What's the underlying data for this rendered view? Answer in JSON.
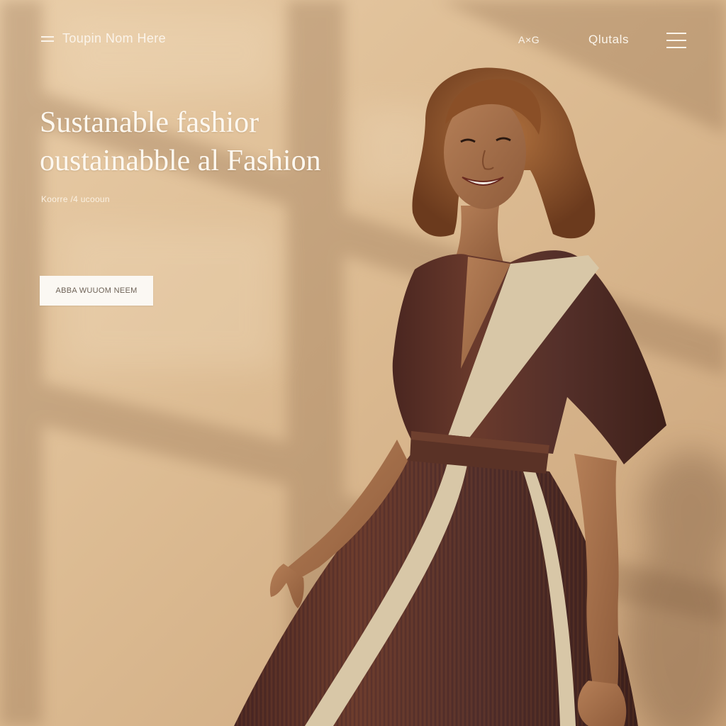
{
  "header": {
    "brand_name": "Toupin Nom Here",
    "nav_links": [
      "A×G",
      "Qlutals"
    ],
    "menu_icon": "hamburger-icon",
    "brand_menu_icon": "menu-icon"
  },
  "hero": {
    "title_line_1": "Sustanable fashior",
    "title_line_2": "oustainabble al Fashion",
    "subtitle": "Koorre /4 ucooun",
    "cta_label": "ABBA WUUOM NEEM"
  },
  "colors": {
    "background": "#dcbb92",
    "text_light": "#fbf4ea",
    "button_bg": "#fbf8f3",
    "button_text": "#6e6257",
    "dress_brown": "#5b3025",
    "dress_stripe": "#d8c7a7",
    "hair": "#9a5b30"
  },
  "image": {
    "subject": "model-in-striped-wrap-dress"
  }
}
